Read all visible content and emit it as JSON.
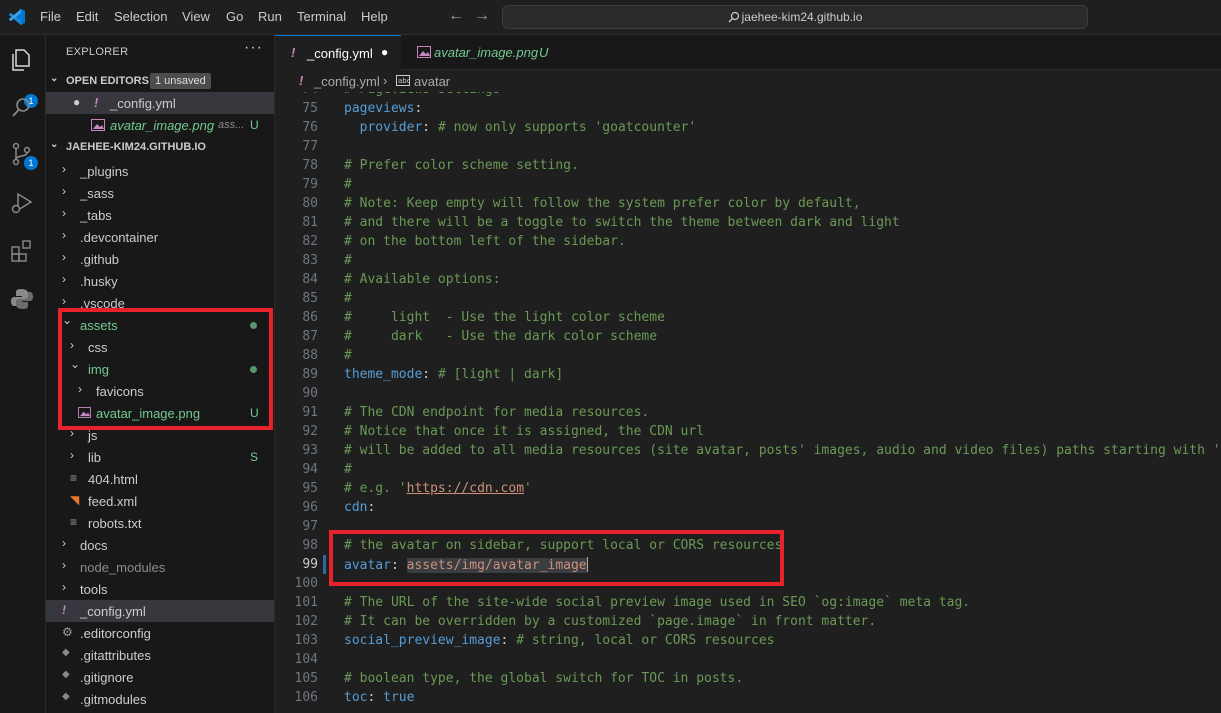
{
  "menu": [
    "File",
    "Edit",
    "Selection",
    "View",
    "Go",
    "Run",
    "Terminal",
    "Help"
  ],
  "search": {
    "label": "jaehee-kim24.github.io"
  },
  "activity": {
    "explorer_badge": "1",
    "scm_badge": "1"
  },
  "explorer": {
    "title": "EXPLORER",
    "more": "···",
    "open_editors_title": "OPEN EDITORS",
    "unsaved_badge": "1 unsaved",
    "open_editors": [
      {
        "icon": "!",
        "name": "_config.yml",
        "detail": "",
        "status": ""
      },
      {
        "icon": "img",
        "name": "avatar_image.png",
        "detail": "ass...",
        "status": "U"
      }
    ],
    "workspace_title": "JAEHEE-KIM24.GITHUB.IO",
    "tree": [
      {
        "name": "_plugins",
        "chevron": "›",
        "status": ""
      },
      {
        "name": "_sass",
        "chevron": "›",
        "status": ""
      },
      {
        "name": "_tabs",
        "chevron": "›",
        "status": ""
      },
      {
        "name": ".devcontainer",
        "chevron": "›",
        "status": ""
      },
      {
        "name": ".github",
        "chevron": "›",
        "status": ""
      },
      {
        "name": ".husky",
        "chevron": "›",
        "status": ""
      },
      {
        "name": ".vscode",
        "chevron": "›",
        "status": ""
      },
      {
        "name": "assets",
        "chevron": "⌄",
        "status": "dot"
      },
      {
        "name": "css",
        "chevron": "›",
        "status": ""
      },
      {
        "name": "img",
        "chevron": "⌄",
        "status": "dot"
      },
      {
        "name": "favicons",
        "chevron": "›",
        "status": ""
      },
      {
        "name": "avatar_image.png",
        "chevron": "",
        "status": "U"
      },
      {
        "name": "js",
        "chevron": "›",
        "status": ""
      },
      {
        "name": "lib",
        "chevron": "›",
        "status": "S"
      },
      {
        "name": "404.html",
        "chevron": "",
        "status": ""
      },
      {
        "name": "feed.xml",
        "chevron": "",
        "status": ""
      },
      {
        "name": "robots.txt",
        "chevron": "",
        "status": ""
      },
      {
        "name": "docs",
        "chevron": "›",
        "status": ""
      },
      {
        "name": "node_modules",
        "chevron": "›",
        "status": ""
      },
      {
        "name": "tools",
        "chevron": "›",
        "status": ""
      },
      {
        "name": "_config.yml",
        "chevron": "",
        "status": ""
      },
      {
        "name": ".editorconfig",
        "chevron": "",
        "status": ""
      },
      {
        "name": ".gitattributes",
        "chevron": "",
        "status": ""
      },
      {
        "name": ".gitignore",
        "chevron": "",
        "status": ""
      },
      {
        "name": ".gitmodules",
        "chevron": "",
        "status": ""
      }
    ]
  },
  "tabs": [
    {
      "icon": "!",
      "label": "_config.yml",
      "status": "●"
    },
    {
      "icon": "img",
      "label": "avatar_image.png",
      "status": "U"
    }
  ],
  "breadcrumb": {
    "file": "_config.yml",
    "sep": "›",
    "symbol": "avatar"
  },
  "code_lines": [
    {
      "n": "74",
      "parts": [
        [
          "c",
          "# Pageviews settings"
        ]
      ]
    },
    {
      "n": "75",
      "parts": [
        [
          "k",
          "pageviews"
        ],
        [
          "t",
          ":"
        ]
      ]
    },
    {
      "n": "76",
      "parts": [
        [
          "t",
          "  "
        ],
        [
          "k",
          "provider"
        ],
        [
          "t",
          ": "
        ],
        [
          "c",
          "# now only supports 'goatcounter'"
        ]
      ]
    },
    {
      "n": "77",
      "parts": []
    },
    {
      "n": "78",
      "parts": [
        [
          "c",
          "# Prefer color scheme setting."
        ]
      ]
    },
    {
      "n": "79",
      "parts": [
        [
          "c",
          "#"
        ]
      ]
    },
    {
      "n": "80",
      "parts": [
        [
          "c",
          "# Note: Keep empty will follow the system prefer color by default,"
        ]
      ]
    },
    {
      "n": "81",
      "parts": [
        [
          "c",
          "# and there will be a toggle to switch the theme between dark and light"
        ]
      ]
    },
    {
      "n": "82",
      "parts": [
        [
          "c",
          "# on the bottom left of the sidebar."
        ]
      ]
    },
    {
      "n": "83",
      "parts": [
        [
          "c",
          "#"
        ]
      ]
    },
    {
      "n": "84",
      "parts": [
        [
          "c",
          "# Available options:"
        ]
      ]
    },
    {
      "n": "85",
      "parts": [
        [
          "c",
          "#"
        ]
      ]
    },
    {
      "n": "86",
      "parts": [
        [
          "c",
          "#     light  - Use the light color scheme"
        ]
      ]
    },
    {
      "n": "87",
      "parts": [
        [
          "c",
          "#     dark   - Use the dark color scheme"
        ]
      ]
    },
    {
      "n": "88",
      "parts": [
        [
          "c",
          "#"
        ]
      ]
    },
    {
      "n": "89",
      "parts": [
        [
          "k",
          "theme_mode"
        ],
        [
          "t",
          ": "
        ],
        [
          "c",
          "# [light | dark]"
        ]
      ]
    },
    {
      "n": "90",
      "parts": []
    },
    {
      "n": "91",
      "parts": [
        [
          "c",
          "# The CDN endpoint for media resources."
        ]
      ]
    },
    {
      "n": "92",
      "parts": [
        [
          "c",
          "# Notice that once it is assigned, the CDN url"
        ]
      ]
    },
    {
      "n": "93",
      "parts": [
        [
          "c",
          "# will be added to all media resources (site avatar, posts' images, audio and video files) paths starting with '/'"
        ]
      ]
    },
    {
      "n": "94",
      "parts": [
        [
          "c",
          "#"
        ]
      ]
    },
    {
      "n": "95",
      "parts": [
        [
          "c",
          "# e.g. '"
        ],
        [
          "l",
          "https://cdn.com"
        ],
        [
          "c",
          "'"
        ]
      ]
    },
    {
      "n": "96",
      "parts": [
        [
          "k",
          "cdn"
        ],
        [
          "t",
          ":"
        ]
      ]
    },
    {
      "n": "97",
      "parts": []
    },
    {
      "n": "98",
      "parts": [
        [
          "c",
          "# the avatar on sidebar, support local or CORS resources"
        ]
      ]
    },
    {
      "n": "99",
      "parts": [
        [
          "k",
          "avatar"
        ],
        [
          "t",
          ": "
        ],
        [
          "s",
          "assets/img/avatar_image"
        ]
      ]
    },
    {
      "n": "100",
      "parts": []
    },
    {
      "n": "101",
      "parts": [
        [
          "c",
          "# The URL of the site-wide social preview image used in SEO `og:image` meta tag."
        ]
      ]
    },
    {
      "n": "102",
      "parts": [
        [
          "c",
          "# It can be overridden by a customized `page.image` in front matter."
        ]
      ]
    },
    {
      "n": "103",
      "parts": [
        [
          "k",
          "social_preview_image"
        ],
        [
          "t",
          ": "
        ],
        [
          "c",
          "# string, local or CORS resources"
        ]
      ]
    },
    {
      "n": "104",
      "parts": []
    },
    {
      "n": "105",
      "parts": [
        [
          "c",
          "# boolean type, the global switch for TOC in posts."
        ]
      ]
    },
    {
      "n": "106",
      "parts": [
        [
          "k",
          "toc"
        ],
        [
          "t",
          ": "
        ],
        [
          "b",
          "true"
        ]
      ]
    }
  ]
}
